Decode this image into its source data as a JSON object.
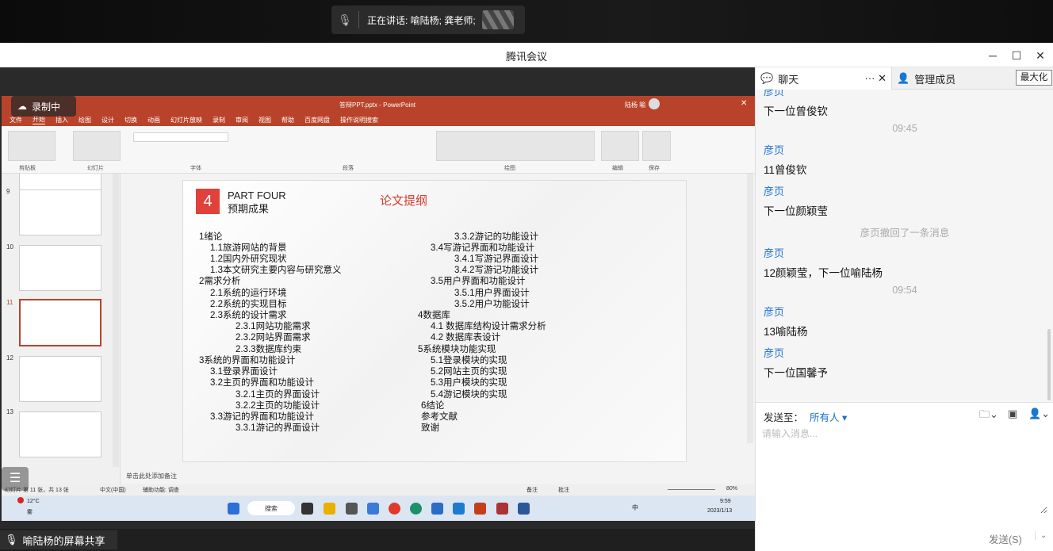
{
  "speaking": {
    "prefix": "正在讲话: 喻陆杨; 龚老师;"
  },
  "window": {
    "title": "腾讯会议",
    "minimize": "─",
    "maximize": "☐",
    "close": "✕"
  },
  "recording": {
    "label": "录制中"
  },
  "ppt": {
    "filename": "答辩PPT.pptx - PowerPoint",
    "user": "陆杨 喻",
    "menu": [
      "文件",
      "开始",
      "插入",
      "绘图",
      "设计",
      "切换",
      "动画",
      "幻灯片放映",
      "录制",
      "审阅",
      "视图",
      "帮助",
      "百度网盘",
      "操作说明搜索"
    ],
    "ribbon_groups": [
      "剪贴板",
      "幻灯片",
      "字体",
      "段落",
      "绘图",
      "编辑",
      "保存"
    ],
    "thumbs": [
      "9",
      "10",
      "11",
      "12",
      "13"
    ],
    "slide": {
      "number": "4",
      "part": "PART FOUR",
      "subtitle": "预期成果",
      "heading": "论文提纲",
      "left_col": [
        "1绪论",
        "1.1旅游网站的背景",
        "1.2国内外研究现状",
        "1.3本文研究主要内容与研究意义",
        "2需求分析",
        "2.1系统的运行环境",
        "2.2系统的实现目标",
        "2.3系统的设计需求",
        "2.3.1网站功能需求",
        "2.3.2网站界面需求",
        "2.3.3数据库约束",
        "3系统的界面和功能设计",
        "3.1登录界面设计",
        "3.2主页的界面和功能设计",
        "3.2.1主页的界面设计",
        "3.2.2主页的功能设计",
        "3.3游记的界面和功能设计",
        "3.3.1游记的界面设计"
      ],
      "right_col": [
        "3.3.2游记的功能设计",
        "3.4写游记界面和功能设计",
        "3.4.1写游记界面设计",
        "3.4.2写游记功能设计",
        "3.5用户界面和功能设计",
        "3.5.1用户界面设计",
        "3.5.2用户功能设计",
        "4数据库",
        "4.1 数据库结构设计需求分析",
        "4.2 数据库表设计",
        "5系统模块功能实现",
        "5.1登录模块的实现",
        "5.2网站主页的实现",
        "5.3用户模块的实现",
        "5.4游记模块的实现",
        "6结论",
        "参考文献",
        "致谢"
      ]
    },
    "notes": "单击此处添加备注",
    "status": {
      "slide_info": "幻灯片 第 11 张，共 13 张",
      "lang": "中文(中国)",
      "accessibility": "辅助功能: 调查",
      "notes_btn": "备注",
      "comments_btn": "批注",
      "zoom": "80%"
    },
    "taskbar": {
      "weather_temp": "12°C",
      "weather_desc": "雾",
      "search": "搜索",
      "time": "9:59",
      "date": "2023/1/13",
      "ime": "中"
    }
  },
  "sharer": {
    "label": "喻陆杨的屏幕共享"
  },
  "chat": {
    "tab_chat": "聊天",
    "tab_more": "··· ✕",
    "tab_members": "管理成员",
    "tooltip": "最大化",
    "messages": [
      {
        "kind": "sender",
        "text": "彦页"
      },
      {
        "kind": "text",
        "text": "下一位曾俊钦"
      },
      {
        "kind": "time",
        "text": "09:45"
      },
      {
        "kind": "sender",
        "text": "彦页"
      },
      {
        "kind": "text",
        "text": "11曾俊钦"
      },
      {
        "kind": "sender",
        "text": "彦页"
      },
      {
        "kind": "text",
        "text": "下一位颜颖莹"
      },
      {
        "kind": "sys",
        "text": "彦页撤回了一条消息"
      },
      {
        "kind": "sender",
        "text": "彦页"
      },
      {
        "kind": "text",
        "text": "12颜颖莹，下一位喻陆杨"
      },
      {
        "kind": "time",
        "text": "09:54"
      },
      {
        "kind": "sender",
        "text": "彦页"
      },
      {
        "kind": "text",
        "text": "13喻陆杨"
      },
      {
        "kind": "sender",
        "text": "彦页"
      },
      {
        "kind": "text",
        "text": "下一位国馨予"
      }
    ],
    "send_to_label": "发送至：",
    "recipient": "所有人 ▾",
    "input_placeholder": "请输入消息...",
    "send_label": "发送(S)",
    "send_drop": "⌄"
  },
  "colors": {
    "accent": "#1a6fd1",
    "ppt_red": "#b9432a",
    "slide_red": "#e0413a"
  }
}
